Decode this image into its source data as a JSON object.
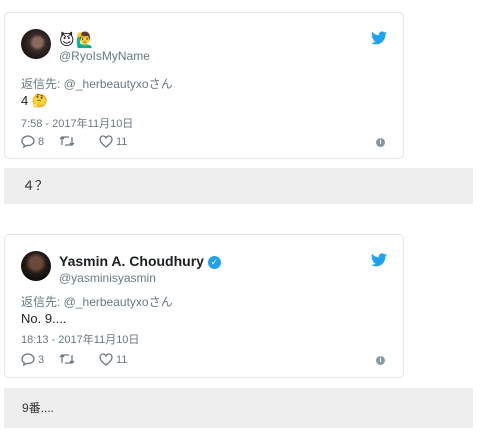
{
  "tweets": [
    {
      "display_name_emoji": "😈🙋‍♂️",
      "handle": "@RyoIsMyName",
      "reply_to": "返信先: @_herbeautyxoさん",
      "text": "4 🤔",
      "timestamp": "7:58 - 2017年11月10日",
      "reply_count": "8",
      "retweet_count": "",
      "like_count": "11",
      "translation": "４？"
    },
    {
      "display_name": "Yasmin A. Choudhury",
      "handle": "@yasminisyasmin",
      "reply_to": "返信先: @_herbeautyxoさん",
      "text": "No. 9....",
      "timestamp": "18:13 - 2017年11月10日",
      "reply_count": "3",
      "retweet_count": "",
      "like_count": "11",
      "translation": "9番...."
    }
  ],
  "colors": {
    "twitter_blue": "#1da1f2",
    "muted": "#697882",
    "translation_bg": "#eeeeee"
  },
  "icons": [
    "reply-icon",
    "retweet-icon",
    "heart-icon",
    "twitter-bird-icon",
    "info-icon",
    "verified-badge-icon"
  ]
}
